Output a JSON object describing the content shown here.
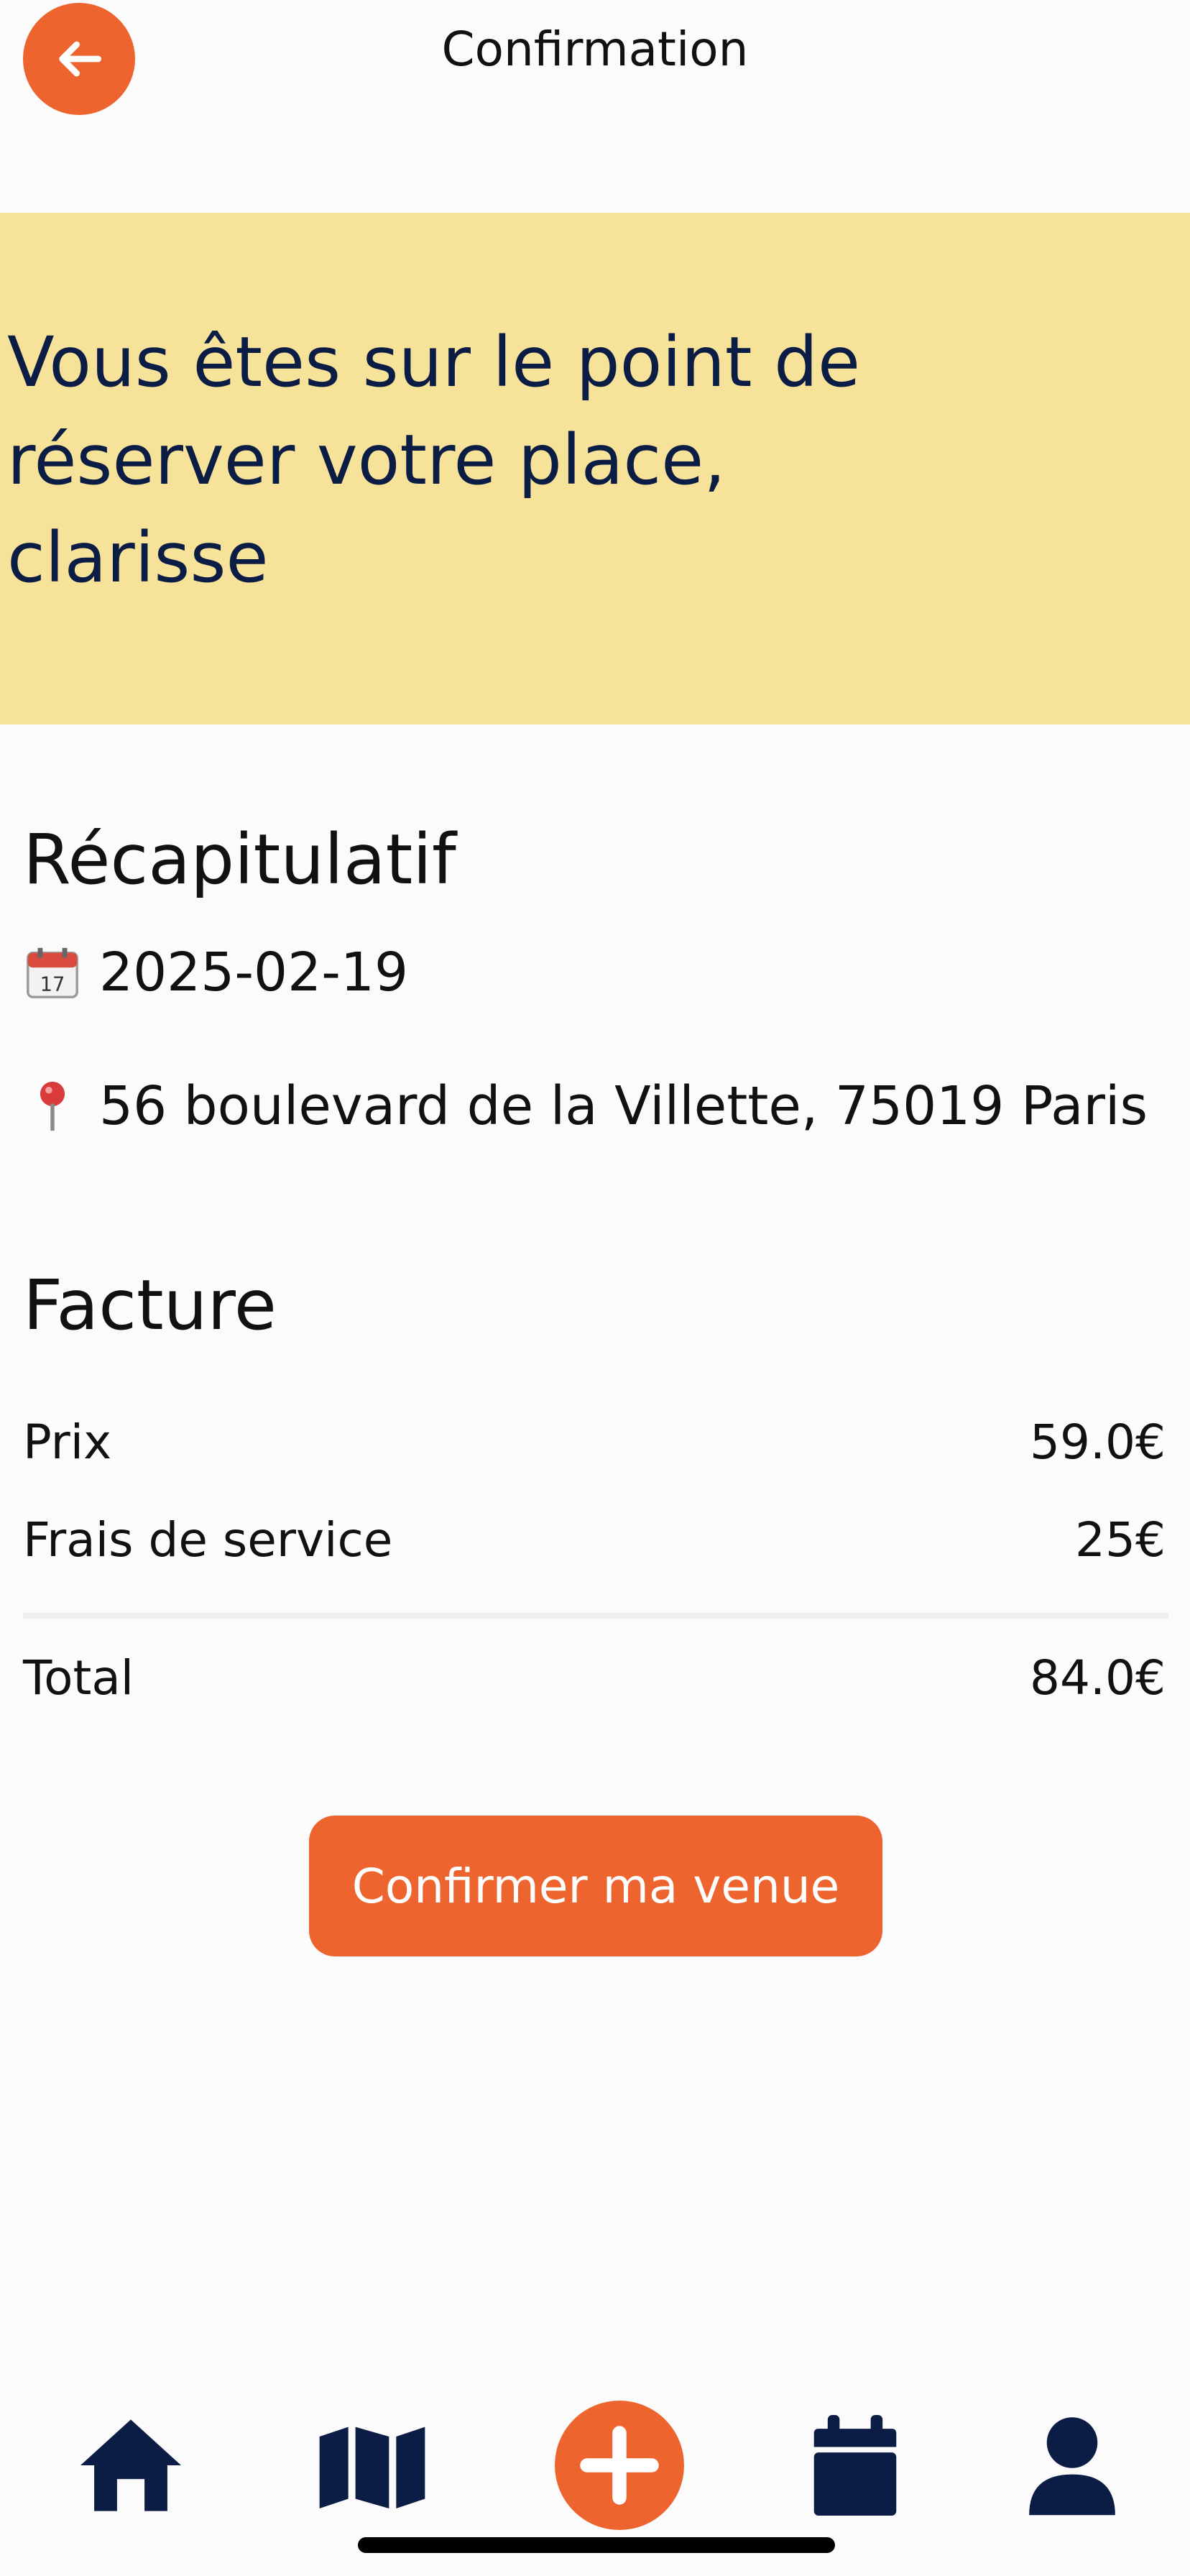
{
  "header": {
    "title": "Confirmation",
    "back_icon": "arrow-left-icon"
  },
  "banner": {
    "line1": "Vous êtes sur le point de",
    "line2": "réserver votre place,",
    "line3": "clarisse",
    "background": "#f7e29a",
    "text_color": "#0b1c45"
  },
  "summary": {
    "title": "Récapitulatif",
    "date_icon": "calendar-icon",
    "date": "2025-02-19",
    "address_icon": "pin-icon",
    "address": "56 boulevard de la Villette, 75019 Paris"
  },
  "invoice": {
    "title": "Facture",
    "rows": [
      {
        "label": "Prix",
        "value": "59.0€"
      },
      {
        "label": "Frais de service",
        "value": "25€"
      }
    ],
    "total_label": "Total",
    "total_value": "84.0€"
  },
  "confirm_button": {
    "label": "Confirmer ma venue"
  },
  "nav": {
    "items": [
      {
        "icon": "home-icon"
      },
      {
        "icon": "map-icon"
      },
      {
        "icon": "plus-icon"
      },
      {
        "icon": "calendar-icon"
      },
      {
        "icon": "profile-icon"
      }
    ]
  },
  "colors": {
    "accent": "#ee642f",
    "navy": "#0b1c45",
    "background": "#fcfbfb"
  }
}
